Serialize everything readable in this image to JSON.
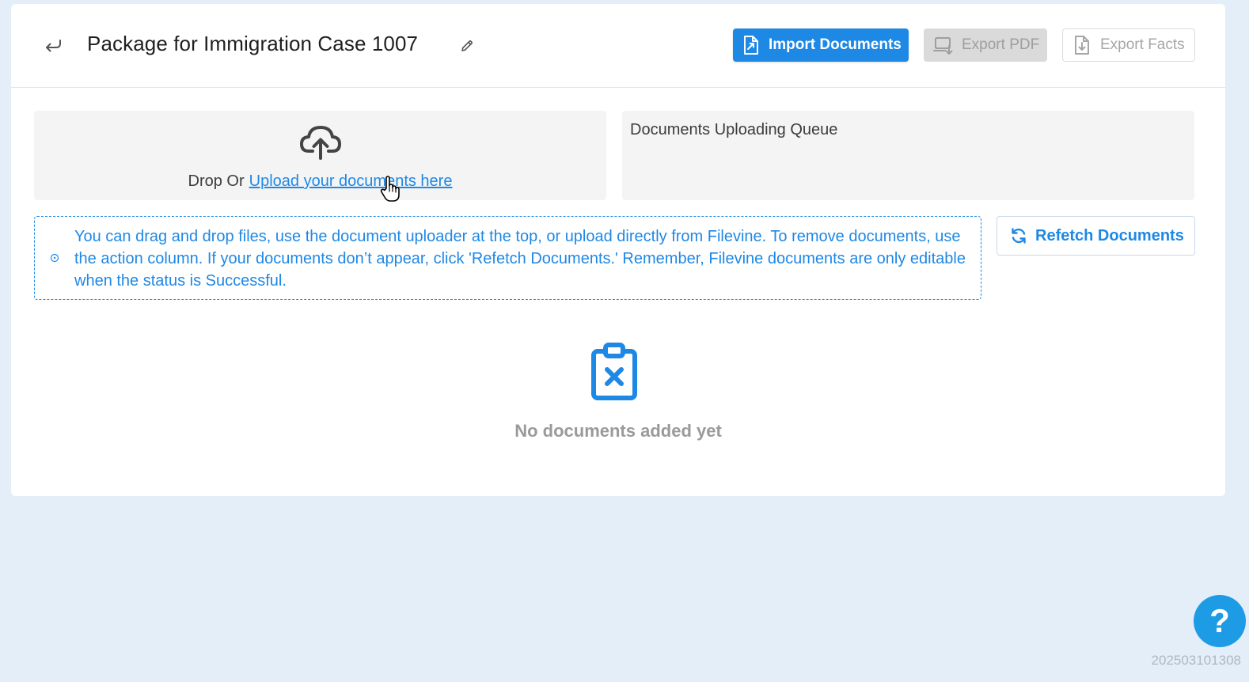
{
  "header": {
    "title": "Package for Immigration Case 1007",
    "import_label": "Import Documents",
    "export_pdf_label": "Export PDF",
    "export_facts_label": "Export Facts"
  },
  "dropzone": {
    "prefix": "Drop Or",
    "link": "Upload your documents here"
  },
  "queue": {
    "title": "Documents Uploading Queue"
  },
  "info": {
    "text": "You can drag and drop files, use the document uploader at the top, or upload directly from Filevine. To remove documents, use the action column. If your documents don’t appear, click 'Refetch Documents.' Remember, Filevine documents are only editable when the status is Successful."
  },
  "refetch_label": "Refetch Documents",
  "empty": {
    "text": "No documents added yet"
  },
  "help_label": "?",
  "version": "202503101308",
  "colors": {
    "accent": "#1e88e5",
    "background": "#e3eef9",
    "disabled_bg": "#dadada",
    "muted_text": "#9a9a9a"
  },
  "icons": {
    "back": "return-arrow-icon",
    "edit": "pencil-icon",
    "import": "file-import-icon",
    "export_pdf": "laptop-download-icon",
    "export_facts": "file-download-icon",
    "upload": "cloud-upload-icon",
    "info": "info-circle-icon",
    "refetch": "refresh-icon",
    "empty": "clipboard-x-icon"
  }
}
